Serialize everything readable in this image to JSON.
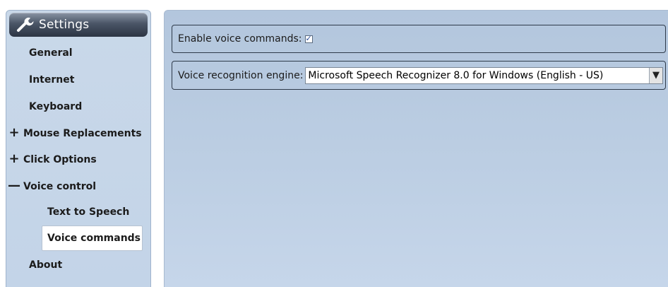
{
  "sidebar": {
    "header": {
      "title": "Settings",
      "icon": "wrench-icon"
    },
    "items": [
      {
        "label": "General",
        "sign": ""
      },
      {
        "label": "Internet",
        "sign": ""
      },
      {
        "label": "Keyboard",
        "sign": ""
      },
      {
        "label": "Mouse Replacements",
        "sign": "+"
      },
      {
        "label": "Click Options",
        "sign": "+"
      },
      {
        "label": "Voice control",
        "sign": "—"
      },
      {
        "label": "Text to Speech",
        "sign": ""
      },
      {
        "label": "Voice commands",
        "sign": "",
        "selected": true
      },
      {
        "label": "About",
        "sign": ""
      }
    ]
  },
  "main": {
    "enable_voice": {
      "label": "Enable voice commands:",
      "checked": true,
      "tick": "✓"
    },
    "engine": {
      "label": "Voice recognition engine:",
      "value": "Microsoft Speech Recognizer 8.0 for Windows (English - US)",
      "arrow": "▼"
    }
  },
  "colors": {
    "sidebar_bg": "#c7d7ea",
    "main_bg": "#b9cbe1",
    "header_dark": "#2c3544"
  }
}
